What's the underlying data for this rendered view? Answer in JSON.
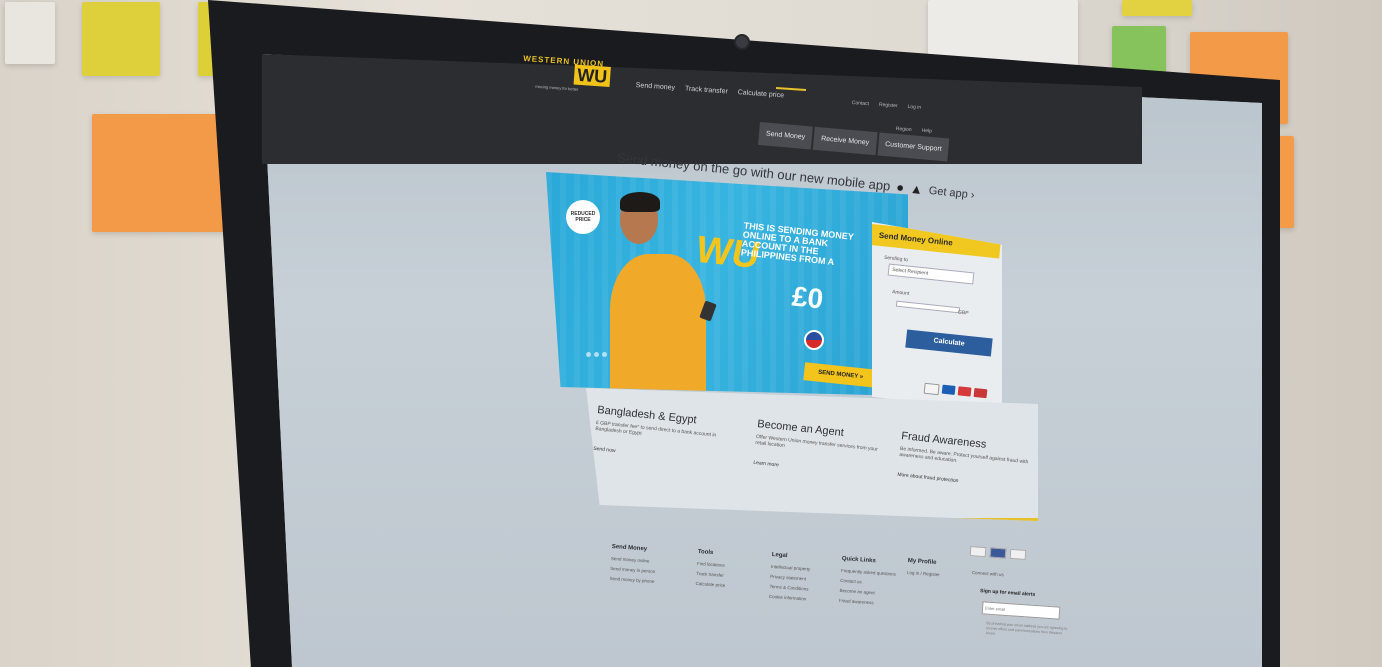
{
  "site": {
    "logo_word": "WESTERN UNION",
    "logo_mark": "WU",
    "logo_tagline": "moving money for better",
    "nav": [
      "Send money",
      "Track transfer",
      "Calculate price"
    ],
    "utility_nav": [
      "Contact",
      "Register",
      "Log in"
    ],
    "utility_nav2": [
      "Region",
      "Help"
    ],
    "subtabs": [
      "Send Money",
      "Receive Money",
      "Customer Support"
    ],
    "mobile_promo": "Send money on the go with our new mobile app",
    "get_app": "Get app ›"
  },
  "hero": {
    "badge": "REDUCED PRICE",
    "wu": "WU",
    "headline": "THIS IS SENDING MONEY ONLINE TO A BANK ACCOUNT IN THE PHILIPPINES FROM A",
    "price": "£0",
    "send_button": "SEND MONEY »"
  },
  "panel": {
    "title": "Send Money Online",
    "label_sending_to": "Sending to",
    "select_value": "Select Recipient",
    "label_amount": "Amount",
    "currency": "GBP",
    "calculate_button": "Calculate"
  },
  "info": [
    {
      "title": "Bangladesh & Egypt",
      "text": "£ GBP transfer fee* to send direct to a bank account in Bangladesh or Egypt",
      "link": "Send now"
    },
    {
      "title": "Become an Agent",
      "text": "Offer Western Union money transfer services from your retail location",
      "link": "Learn more"
    },
    {
      "title": "Fraud Awareness",
      "text": "Be informed. Be aware. Protect yourself against fraud with awareness and education.",
      "link": "More about fraud protection"
    }
  ],
  "footer": {
    "columns": [
      {
        "title": "Send Money",
        "items": [
          "Send money online",
          "Send money in person",
          "Send money by phone"
        ]
      },
      {
        "title": "Tools",
        "items": [
          "Find locations",
          "Track transfer",
          "Calculate price"
        ]
      },
      {
        "title": "Legal",
        "items": [
          "Intellectual property",
          "Privacy statement",
          "Terms & Conditions",
          "Cookie information"
        ]
      },
      {
        "title": "Quick Links",
        "items": [
          "Frequently asked questions",
          "Contact us",
          "Become an agent",
          "Fraud awareness"
        ]
      },
      {
        "title": "My Profile",
        "items": [
          "Log in / Register"
        ]
      }
    ],
    "connect": "Connect with us",
    "signup": "Sign up for email alerts",
    "signup_placeholder": "Enter email",
    "fine_print": "By providing your email address you are agreeing to receive offers and communications from Western Union."
  },
  "colors": {
    "brand_yellow": "#f1c81f",
    "hero_blue": "#2aa8d8",
    "calc_blue": "#2c5e9e",
    "header_dark": "#2c2d31"
  }
}
